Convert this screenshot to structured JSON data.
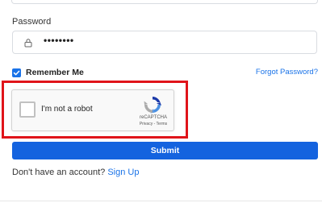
{
  "form": {
    "password_label": "Password",
    "password_value": "••••••••",
    "remember_label": "Remember Me",
    "remember_checked": true,
    "forgot_link": "Forgot Password?",
    "submit_label": "Submit",
    "signup_prompt": "Don't have an account?",
    "signup_link": "Sign Up"
  },
  "recaptcha": {
    "checkbox_label": "I'm not a robot",
    "brand": "reCAPTCHA",
    "terms": "Privacy - Terms",
    "icon": "recaptcha-logo-icon"
  },
  "icons": {
    "lock": "lock-icon",
    "check": "check-icon"
  },
  "colors": {
    "accent": "#1463df",
    "link": "#1a73e8",
    "highlight": "#e0141a"
  }
}
